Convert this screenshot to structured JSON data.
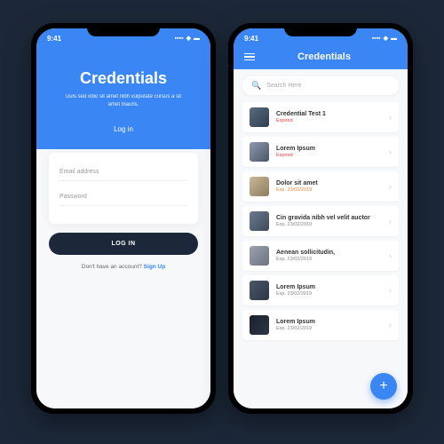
{
  "status": {
    "time": "9:41"
  },
  "login": {
    "title": "Credentials",
    "subtitle": "Duis sed odio sit amet nibh vulputate cursus a sit amet mauris.",
    "tab": "Log in",
    "email_placeholder": "Email address",
    "password_placeholder": "Password",
    "button": "LOG IN",
    "signup_prompt": "Don't have an account? ",
    "signup_link": "Sign Up"
  },
  "list": {
    "title": "Credentials",
    "search_placeholder": "Search Here",
    "items": [
      {
        "title": "Credential Test 1",
        "sub": "Expired",
        "status": "expired"
      },
      {
        "title": "Lorem Ipsum",
        "sub": "Expired",
        "status": "expired"
      },
      {
        "title": "Dolor sit amet",
        "sub": "Exp. 23/02/2019",
        "status": "orange"
      },
      {
        "title": "Cin gravida nibh vel velit auctor",
        "sub": "Exp. 23/02/2019",
        "status": "gray"
      },
      {
        "title": "Aenean sollicitudin,",
        "sub": "Exp. 23/02/2019",
        "status": "gray"
      },
      {
        "title": "Lorem Ipsum",
        "sub": "Exp. 23/02/2019",
        "status": "gray"
      },
      {
        "title": "Lorem Ipsum",
        "sub": "Exp. 23/02/2019",
        "status": "gray"
      }
    ]
  }
}
